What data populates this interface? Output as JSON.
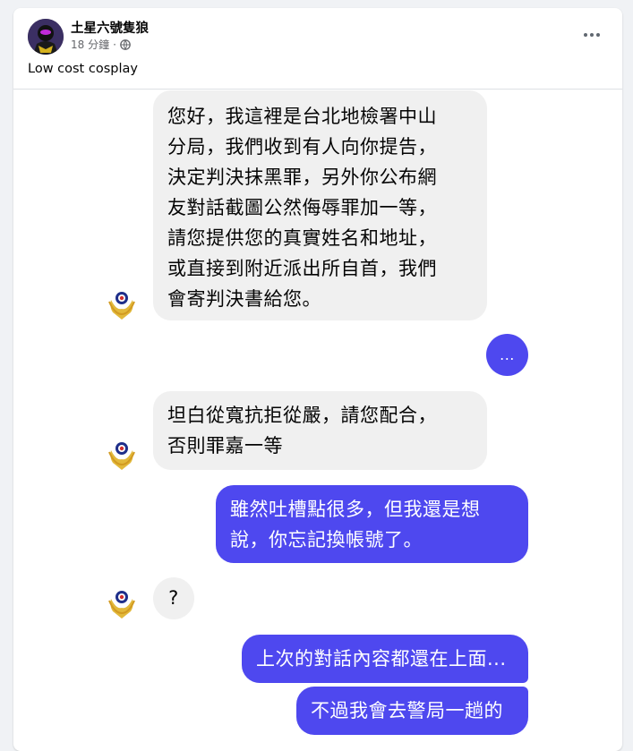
{
  "post": {
    "author": "土星六號隻狼",
    "time": "18 分鐘",
    "time_separator": "·",
    "privacy_icon": "globe-icon",
    "caption": "Low cost cosplay",
    "more_icon": "more-options-icon"
  },
  "conversation": {
    "messages": [
      {
        "sender": "them",
        "text": "您好，我這裡是台北地檢署中山\n分局，我們收到有人向你提告，\n決定判決抹黑罪，另外你公布網\n友對話截圖公然侮辱罪加一等，\n請您提供您的真實姓名和地址，\n或直接到附近派出所自首，我們\n會寄判決書給您。"
      },
      {
        "sender": "me",
        "text": "..."
      },
      {
        "sender": "them",
        "text": "坦白從寬抗拒從嚴，請您配合，\n否則罪嘉一等"
      },
      {
        "sender": "me",
        "text": "雖然吐槽點很多，但我還是想\n說，你忘記換帳號了。"
      },
      {
        "sender": "them",
        "text": "?"
      },
      {
        "sender": "me",
        "text": "上次的對話內容都還在上面..."
      },
      {
        "sender": "me",
        "text": "不過我會去警局一趟的"
      }
    ]
  },
  "colors": {
    "outgoing_bubble": "#4e48ef",
    "incoming_bubble": "#f0f0f0",
    "seal_gold": "#e2b93b",
    "seal_blue": "#1f2f8a"
  }
}
